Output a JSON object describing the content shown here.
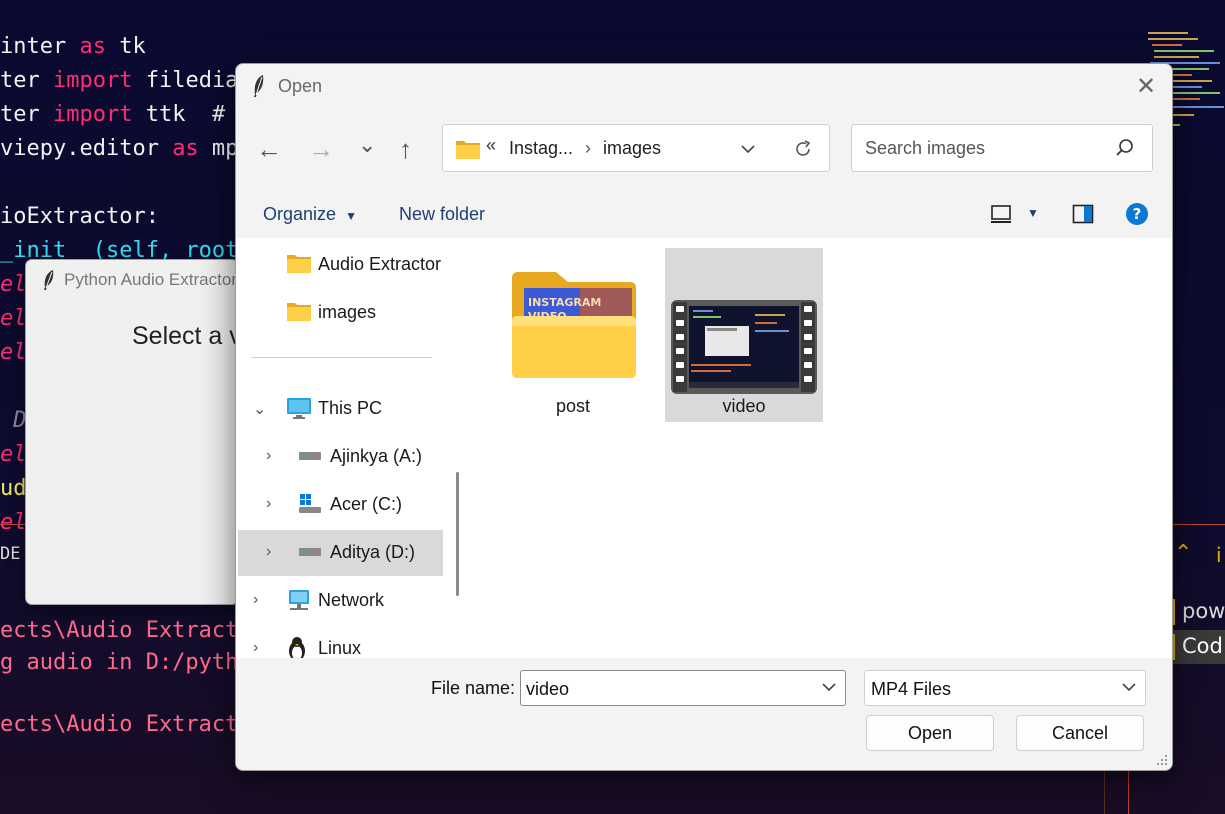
{
  "editor": {
    "code_lines": [
      {
        "parts": [
          [
            "",
            "inter "
          ],
          [
            "kw",
            "as"
          ],
          [
            "",
            " tk"
          ]
        ]
      },
      {
        "parts": [
          [
            "",
            "ter "
          ],
          [
            "kw",
            "import"
          ],
          [
            "",
            " filedia"
          ]
        ]
      },
      {
        "parts": [
          [
            "",
            "ter "
          ],
          [
            "kw",
            "import"
          ],
          [
            "",
            " ttk  #"
          ]
        ]
      },
      {
        "parts": [
          [
            "",
            "viepy.editor "
          ],
          [
            "kw",
            "as"
          ],
          [
            "",
            " mp"
          ]
        ]
      },
      {
        "parts": [
          [
            "",
            "ioExtractor:"
          ]
        ]
      },
      {
        "parts": [
          [
            "fn",
            "_init__(self, root"
          ]
        ]
      },
      {
        "parts": [
          [
            "self",
            "elf"
          ]
        ]
      },
      {
        "parts": [
          [
            "self",
            "elf"
          ]
        ]
      },
      {
        "parts": [
          [
            "self",
            "elf"
          ]
        ]
      },
      {
        "parts": [
          [
            "cm",
            " De"
          ]
        ]
      },
      {
        "parts": [
          [
            "self",
            "elf"
          ]
        ]
      },
      {
        "parts": [
          [
            "yl",
            "udi"
          ]
        ]
      },
      {
        "parts": [
          [
            "self",
            "elf"
          ]
        ]
      }
    ],
    "terminal_tab": "DE",
    "terminal_lines": [
      "ects\\Audio Extract",
      "g audio in D:/pytho",
      "",
      "ects\\Audio Extract"
    ],
    "right_panel": {
      "items": [
        "pow",
        "Cod"
      ]
    }
  },
  "tk_window": {
    "title": "Python Audio Extractor",
    "message": "Select a vi"
  },
  "dialog": {
    "title": "Open",
    "close_icon": "close-icon",
    "nav": {
      "back": "←",
      "forward": "→",
      "recent": "⌄",
      "up": "↑"
    },
    "address": {
      "prefix": "«",
      "crumb1": "Instag...",
      "sep": "›",
      "crumb2": "images"
    },
    "search_placeholder": "Search images",
    "toolbar": {
      "organize": "Organize",
      "new_folder": "New folder"
    },
    "nav_pane": {
      "quick": [
        {
          "label": "Audio Extractor"
        },
        {
          "label": "images"
        }
      ],
      "tree": [
        {
          "label": "This PC",
          "expanded": true
        },
        {
          "label": "Ajinkya (A:)"
        },
        {
          "label": "Acer (C:)"
        },
        {
          "label": "Aditya (D:)",
          "selected": true
        },
        {
          "label": "Network"
        },
        {
          "label": "Linux"
        }
      ]
    },
    "items": [
      {
        "label": "post",
        "type": "folder",
        "thumb_text": "INSTAGRAM VIDEO"
      },
      {
        "label": "video",
        "type": "video",
        "selected": true
      }
    ],
    "file_name_label": "File name:",
    "file_name_value": "video",
    "file_type": "MP4 Files",
    "open_button": "Open",
    "cancel_button": "Cancel"
  },
  "colors": {
    "accent": "#1f3f73",
    "help": "#0a78d4",
    "selection": "#d9d9d9"
  }
}
